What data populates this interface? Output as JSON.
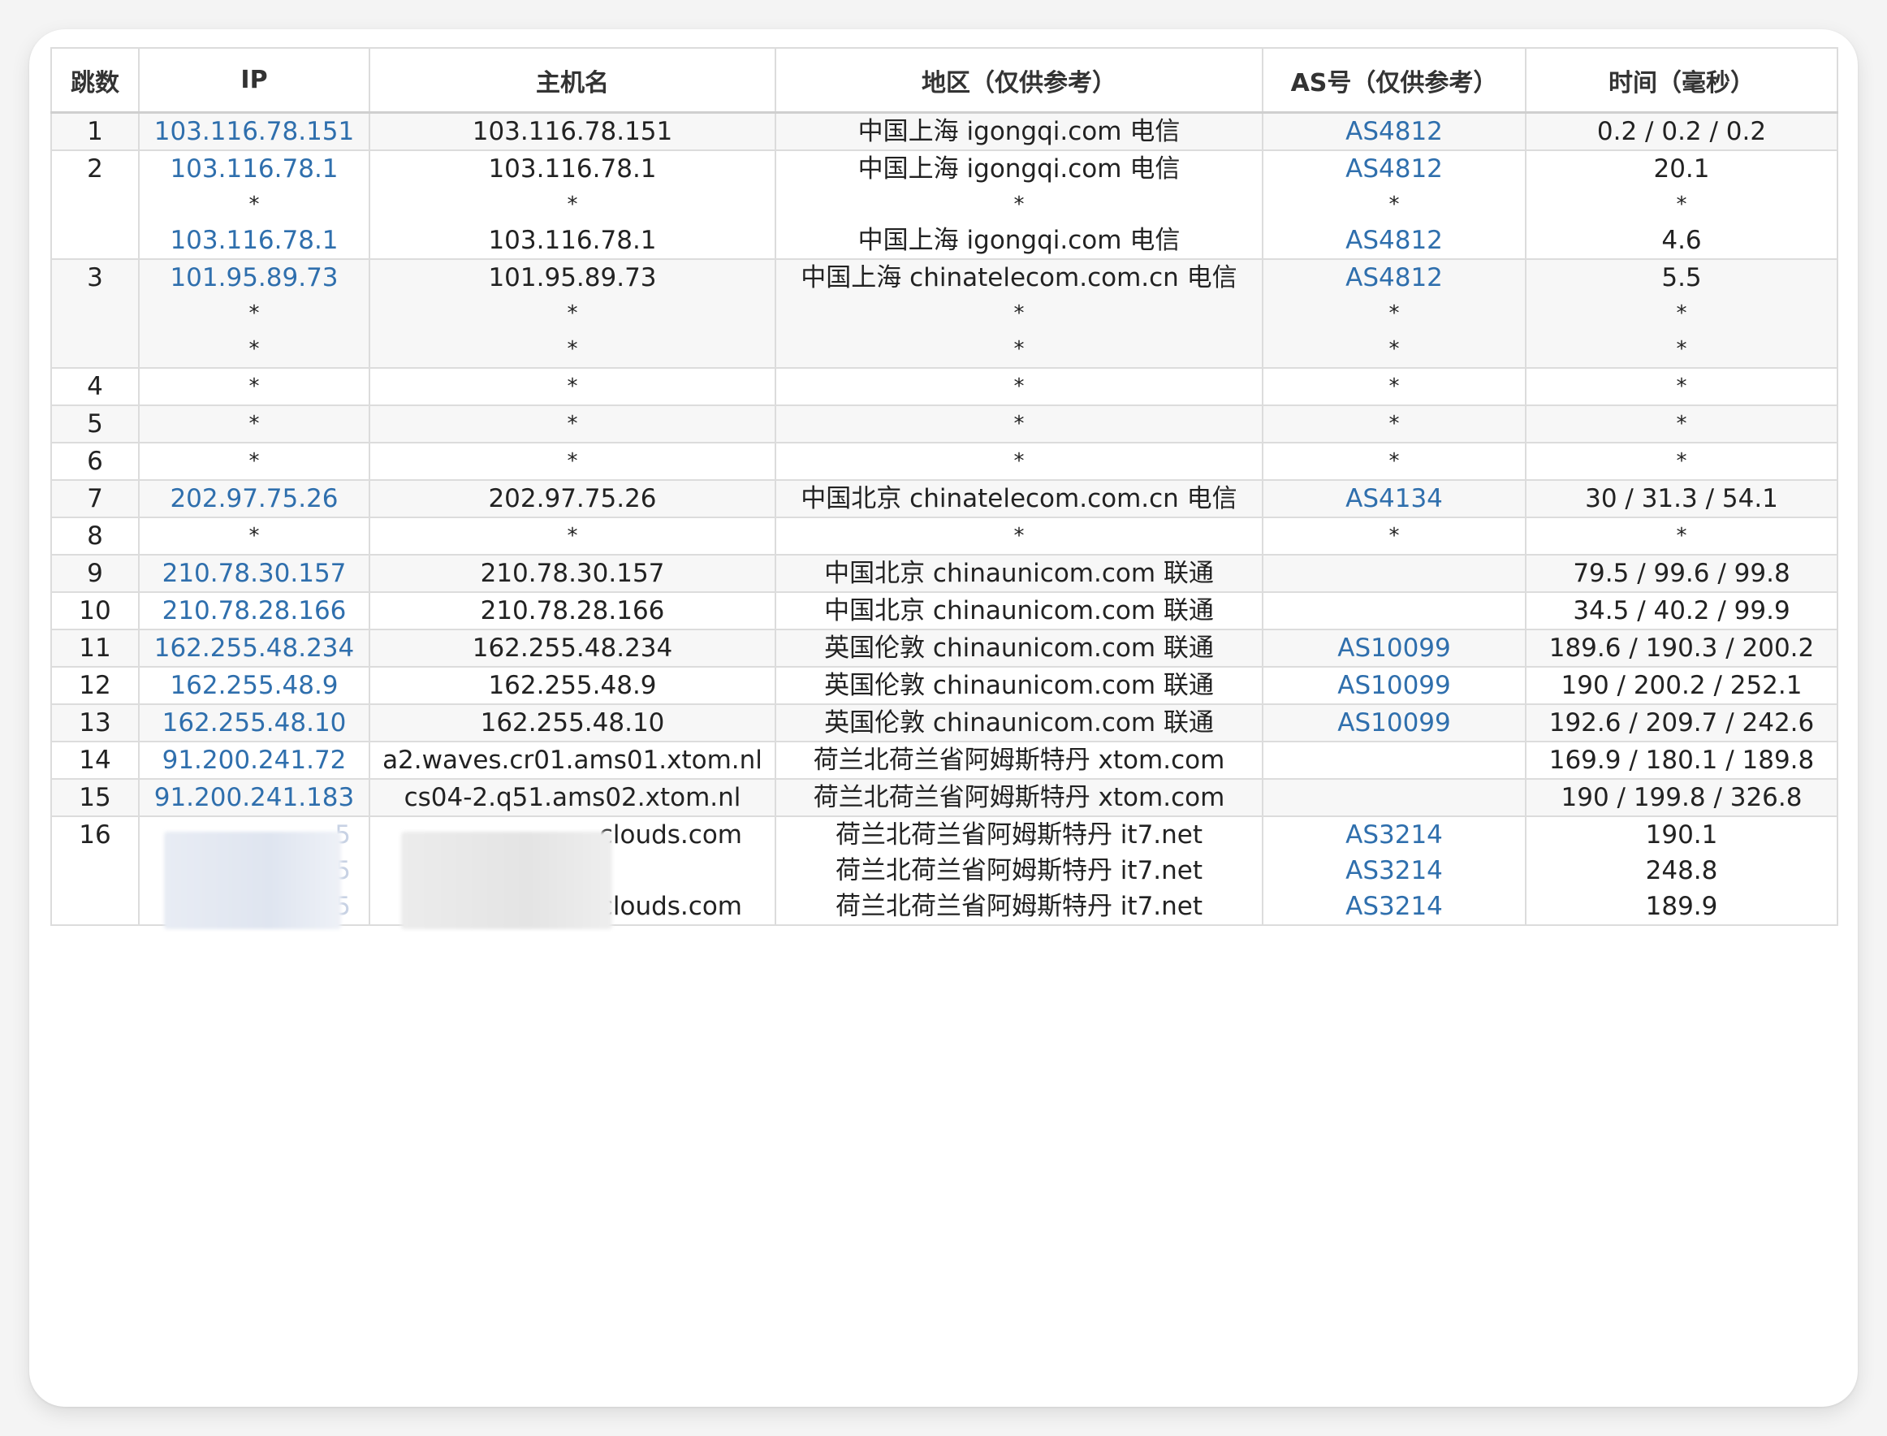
{
  "headers": {
    "hop": "跳数",
    "ip": "IP",
    "hostname": "主机名",
    "region": "地区（仅供参考）",
    "as": "AS号（仅供参考）",
    "time": "时间（毫秒）"
  },
  "rows": [
    {
      "hop": "1",
      "ip": [
        "103.116.78.151"
      ],
      "host": [
        "103.116.78.151"
      ],
      "region": [
        "中国上海 igongqi.com 电信"
      ],
      "as": [
        "AS4812"
      ],
      "time": [
        "0.2 / 0.2 / 0.2"
      ]
    },
    {
      "hop": "2",
      "ip": [
        "103.116.78.1",
        "*",
        "103.116.78.1"
      ],
      "host": [
        "103.116.78.1",
        "*",
        "103.116.78.1"
      ],
      "region": [
        "中国上海 igongqi.com 电信",
        "*",
        "中国上海 igongqi.com 电信"
      ],
      "as": [
        "AS4812",
        "*",
        "AS4812"
      ],
      "time": [
        "20.1",
        "*",
        "4.6"
      ]
    },
    {
      "hop": "3",
      "ip": [
        "101.95.89.73",
        "*",
        "*"
      ],
      "host": [
        "101.95.89.73",
        "*",
        "*"
      ],
      "region": [
        "中国上海 chinatelecom.com.cn 电信",
        "*",
        "*"
      ],
      "as": [
        "AS4812",
        "*",
        "*"
      ],
      "time": [
        "5.5",
        "*",
        "*"
      ]
    },
    {
      "hop": "4",
      "ip": [
        "*"
      ],
      "host": [
        "*"
      ],
      "region": [
        "*"
      ],
      "as": [
        "*"
      ],
      "time": [
        "*"
      ]
    },
    {
      "hop": "5",
      "ip": [
        "*"
      ],
      "host": [
        "*"
      ],
      "region": [
        "*"
      ],
      "as": [
        "*"
      ],
      "time": [
        "*"
      ]
    },
    {
      "hop": "6",
      "ip": [
        "*"
      ],
      "host": [
        "*"
      ],
      "region": [
        "*"
      ],
      "as": [
        "*"
      ],
      "time": [
        "*"
      ]
    },
    {
      "hop": "7",
      "ip": [
        "202.97.75.26"
      ],
      "host": [
        "202.97.75.26"
      ],
      "region": [
        "中国北京 chinatelecom.com.cn 电信"
      ],
      "as": [
        "AS4134"
      ],
      "time": [
        "30 / 31.3 / 54.1"
      ]
    },
    {
      "hop": "8",
      "ip": [
        "*"
      ],
      "host": [
        "*"
      ],
      "region": [
        "*"
      ],
      "as": [
        "*"
      ],
      "time": [
        "*"
      ]
    },
    {
      "hop": "9",
      "ip": [
        "210.78.30.157"
      ],
      "host": [
        "210.78.30.157"
      ],
      "region": [
        "中国北京 chinaunicom.com 联通"
      ],
      "as": [
        ""
      ],
      "time": [
        "79.5 / 99.6 / 99.8"
      ]
    },
    {
      "hop": "10",
      "ip": [
        "210.78.28.166"
      ],
      "host": [
        "210.78.28.166"
      ],
      "region": [
        "中国北京 chinaunicom.com 联通"
      ],
      "as": [
        ""
      ],
      "time": [
        "34.5 / 40.2 / 99.9"
      ]
    },
    {
      "hop": "11",
      "ip": [
        "162.255.48.234"
      ],
      "host": [
        "162.255.48.234"
      ],
      "region": [
        "英国伦敦 chinaunicom.com 联通"
      ],
      "as": [
        "AS10099"
      ],
      "time": [
        "189.6 / 190.3 / 200.2"
      ]
    },
    {
      "hop": "12",
      "ip": [
        "162.255.48.9"
      ],
      "host": [
        "162.255.48.9"
      ],
      "region": [
        "英国伦敦 chinaunicom.com 联通"
      ],
      "as": [
        "AS10099"
      ],
      "time": [
        "190 / 200.2 / 252.1"
      ]
    },
    {
      "hop": "13",
      "ip": [
        "162.255.48.10"
      ],
      "host": [
        "162.255.48.10"
      ],
      "region": [
        "英国伦敦 chinaunicom.com 联通"
      ],
      "as": [
        "AS10099"
      ],
      "time": [
        "192.6 / 209.7 / 242.6"
      ]
    },
    {
      "hop": "14",
      "ip": [
        "91.200.241.72"
      ],
      "host": [
        "a2.waves.cr01.ams01.xtom.nl"
      ],
      "region": [
        "荷兰北荷兰省阿姆斯特丹 xtom.com"
      ],
      "as": [
        ""
      ],
      "time": [
        "169.9 / 180.1 / 189.8"
      ]
    },
    {
      "hop": "15",
      "ip": [
        "91.200.241.183"
      ],
      "host": [
        "cs04-2.q51.ams02.xtom.nl"
      ],
      "region": [
        "荷兰北荷兰省阿姆斯特丹 xtom.com"
      ],
      "as": [
        ""
      ],
      "time": [
        "190 / 199.8 / 326.8"
      ]
    },
    {
      "hop": "16",
      "ip": [
        "5",
        "5",
        "5"
      ],
      "host": [
        "clouds.com",
        "",
        "clouds.com"
      ],
      "region": [
        "荷兰北荷兰省阿姆斯特丹 it7.net",
        "荷兰北荷兰省阿姆斯特丹 it7.net",
        "荷兰北荷兰省阿姆斯特丹 it7.net"
      ],
      "as": [
        "AS3214",
        "AS3214",
        "AS3214"
      ],
      "time": [
        "190.1",
        "248.8",
        "189.9"
      ],
      "redacted": true
    }
  ],
  "colors": {
    "link": "#2f6fad",
    "border": "#dcdcdc",
    "stripe": "#f7f7f7",
    "text": "#222222"
  }
}
